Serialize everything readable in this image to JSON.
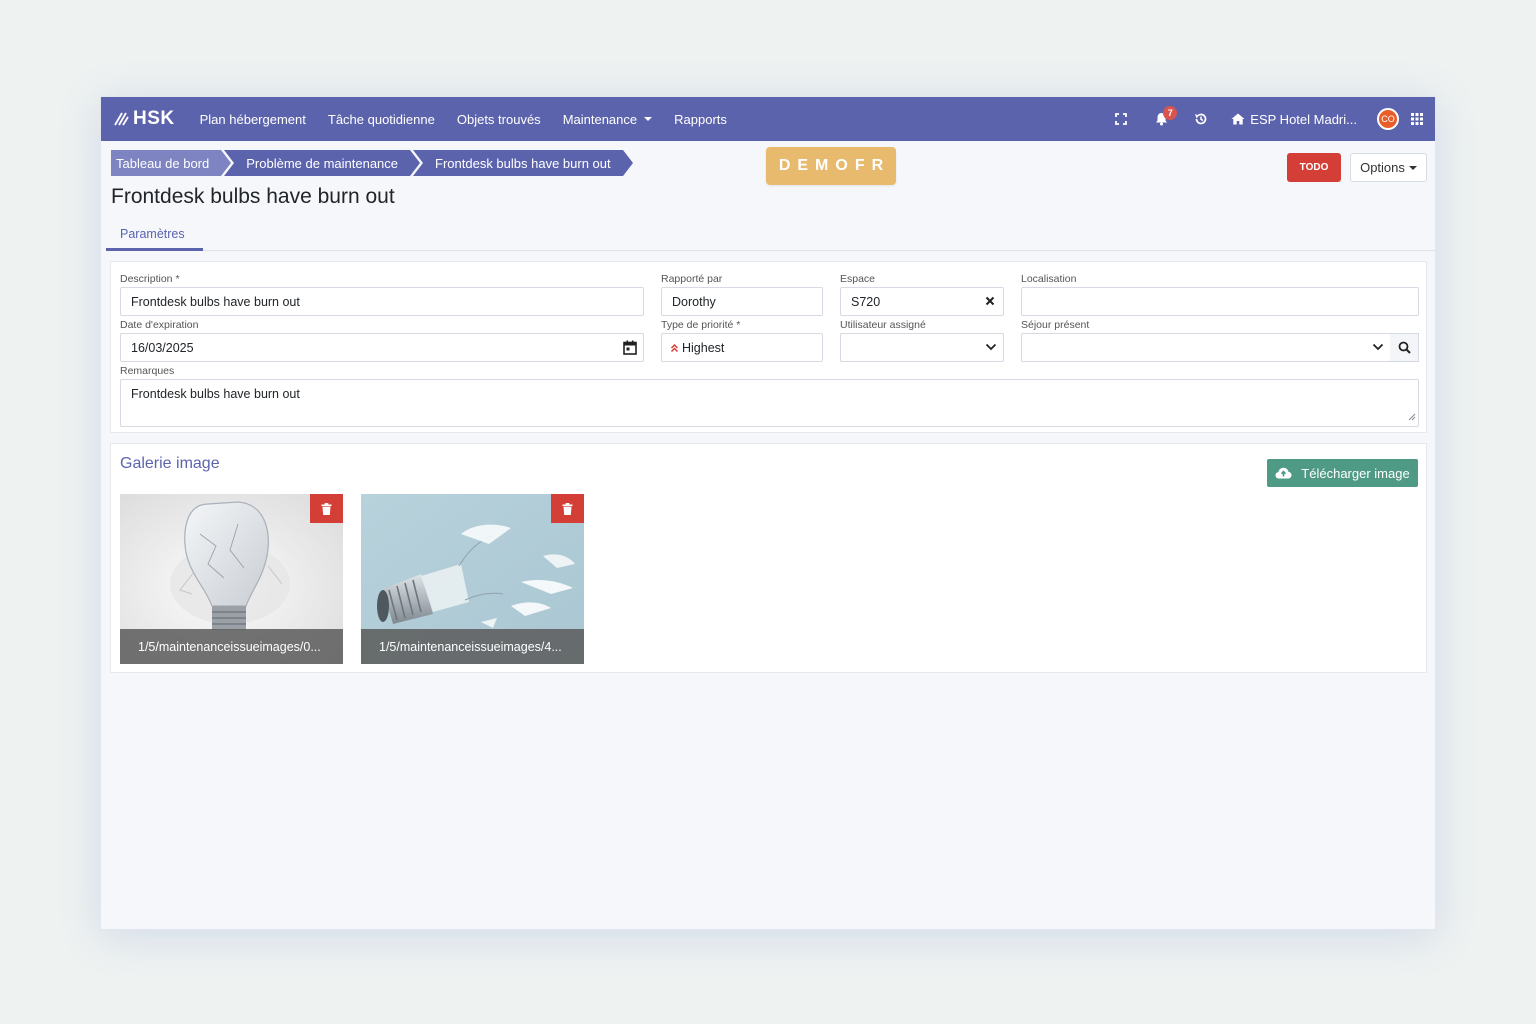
{
  "navbar": {
    "brand": "HSK",
    "items": [
      {
        "label": "Plan hébergement"
      },
      {
        "label": "Tâche quotidienne"
      },
      {
        "label": "Objets trouvés"
      },
      {
        "label": "Maintenance"
      },
      {
        "label": "Rapports"
      }
    ],
    "notification_count": "7",
    "hotel": "ESP Hotel Madri...",
    "avatar_initials": "CO"
  },
  "breadcrumb": [
    "Tableau de bord",
    "Problème de maintenance",
    "Frontdesk bulbs have burn out"
  ],
  "demo_badge": "DEMOFR",
  "status_button": "TODO",
  "options_button": "Options",
  "page_title": "Frontdesk bulbs have burn out",
  "tabs": [
    {
      "label": "Paramètres",
      "active": true
    }
  ],
  "form": {
    "description": {
      "label": "Description *",
      "value": "Frontdesk bulbs have burn out"
    },
    "reported_by": {
      "label": "Rapporté par",
      "value": "Dorothy"
    },
    "space": {
      "label": "Espace",
      "value": "S720"
    },
    "location": {
      "label": "Localisation",
      "value": ""
    },
    "expiry_date": {
      "label": "Date d'expiration",
      "value": "16/03/2025"
    },
    "priority": {
      "label": "Type de priorité *",
      "value": "Highest"
    },
    "assigned_user": {
      "label": "Utilisateur assigné",
      "value": ""
    },
    "current_stay": {
      "label": "Séjour présent",
      "value": ""
    },
    "remarks": {
      "label": "Remarques",
      "value": "Frontdesk bulbs have burn out"
    }
  },
  "gallery": {
    "title": "Galerie image",
    "upload_label": "Télécharger image",
    "images": [
      {
        "caption": "1/5/maintenanceissueimages/0..."
      },
      {
        "caption": "1/5/maintenanceissueimages/4..."
      }
    ]
  },
  "colors": {
    "primary": "#5c63ad",
    "danger": "#d33f36",
    "success": "#4f9a84",
    "demo": "#e7ba6e"
  }
}
